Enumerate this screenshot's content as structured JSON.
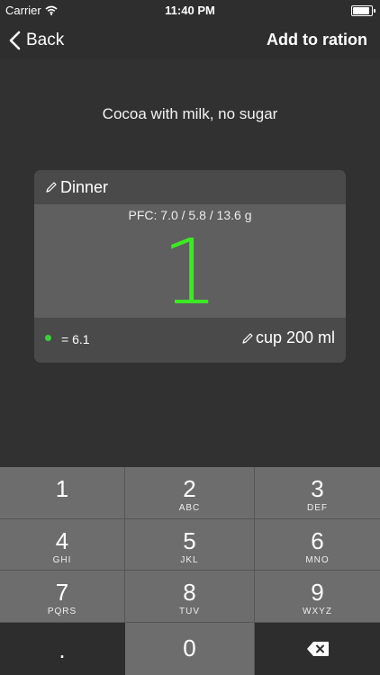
{
  "status": {
    "carrier": "Carrier",
    "time": "11:40 PM",
    "battery_level": 0.95
  },
  "nav": {
    "back_label": "Back",
    "action_label": "Add to ration"
  },
  "food": {
    "title": "Cocoa with milk, no sugar"
  },
  "card": {
    "meal": "Dinner",
    "pfc": "PFC: 7.0 / 5.8 / 13.6 g",
    "quantity": "1",
    "index_value": "= 6.1",
    "portion": "cup 200 ml"
  },
  "keypad": [
    {
      "digit": "1",
      "letters": ""
    },
    {
      "digit": "2",
      "letters": "ABC"
    },
    {
      "digit": "3",
      "letters": "DEF"
    },
    {
      "digit": "4",
      "letters": "GHI"
    },
    {
      "digit": "5",
      "letters": "JKL"
    },
    {
      "digit": "6",
      "letters": "MNO"
    },
    {
      "digit": "7",
      "letters": "PQRS"
    },
    {
      "digit": "8",
      "letters": "TUV"
    },
    {
      "digit": "9",
      "letters": "WXYZ"
    }
  ],
  "keypad_bottom": {
    "decimal": ".",
    "zero": "0"
  },
  "colors": {
    "accent_green": "#3bea22",
    "background": "#313131"
  },
  "icons": [
    "wifi-icon",
    "battery-icon",
    "chevron-left-icon",
    "pencil-icon",
    "green-dot-icon",
    "backspace-icon"
  ]
}
